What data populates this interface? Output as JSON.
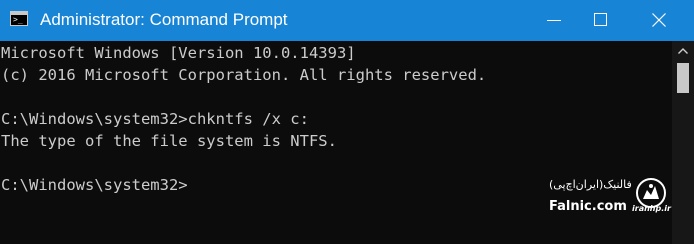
{
  "window": {
    "title": "Administrator: Command Prompt",
    "accent_color": "#1784d6",
    "icons": {
      "app": "command-prompt-icon",
      "minimize": "minimize-icon",
      "maximize": "maximize-icon",
      "close": "close-icon"
    }
  },
  "console": {
    "lines": [
      "Microsoft Windows [Version 10.0.14393]",
      "(c) 2016 Microsoft Corporation. All rights reserved.",
      "C:\\Windows\\system32>chkntfs /x c:",
      "The type of the file system is NTFS.",
      "C:\\Windows\\system32>"
    ],
    "text_color": "#cccccc",
    "background": "#0c0c0c"
  },
  "watermark": {
    "persian_text": "فالنیک(ایران‌اچ‌پی)",
    "english_text": "Falnic.com",
    "logo_text": "iranhp.ir"
  }
}
